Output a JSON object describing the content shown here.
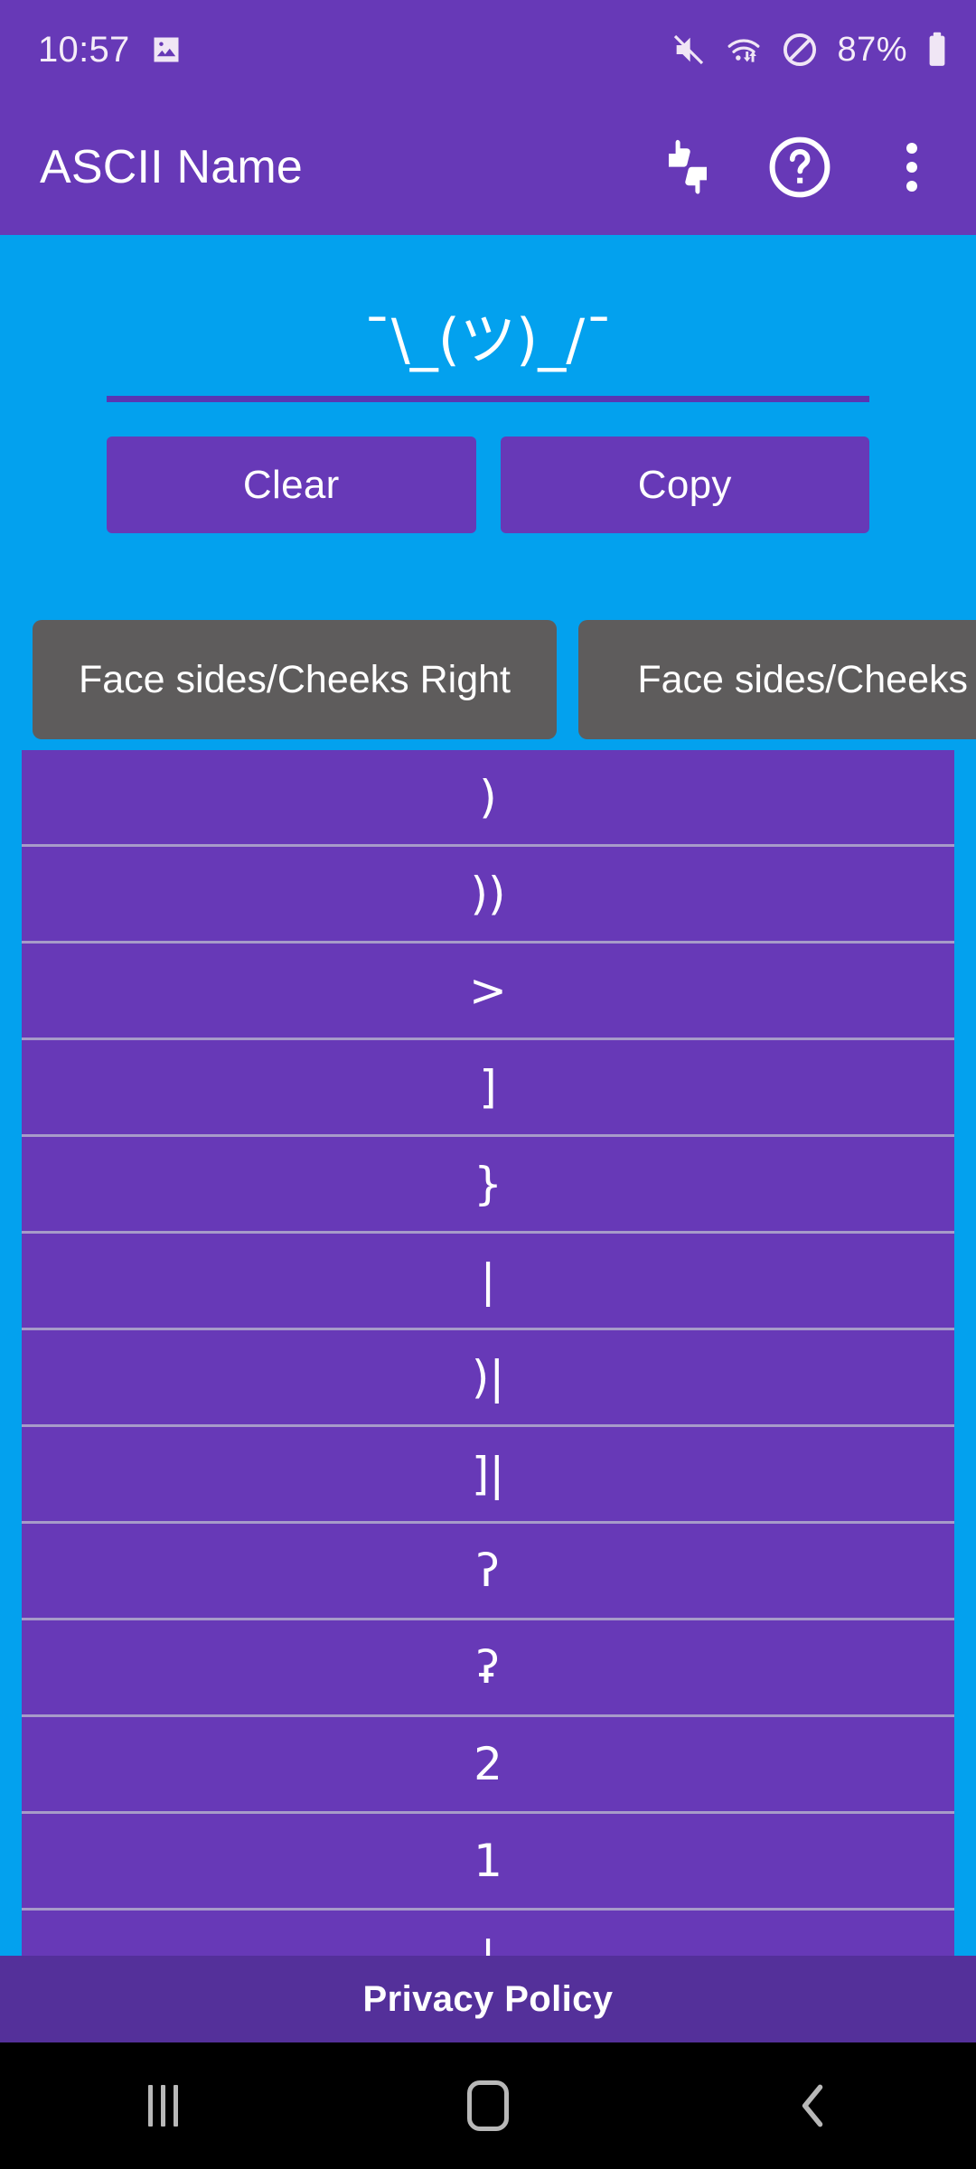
{
  "status_bar": {
    "time": "10:57",
    "battery_percent": "87%",
    "icons": [
      "image-icon",
      "mute-icon",
      "wifi-icon",
      "do-not-disturb-icon",
      "battery-icon"
    ]
  },
  "app_bar": {
    "title": "ASCII Name",
    "actions": [
      "thumbs-feedback-icon",
      "help-icon",
      "overflow-menu-icon"
    ]
  },
  "editor": {
    "value": "¯\\_(ツ)_/¯",
    "clear_label": "Clear",
    "copy_label": "Copy"
  },
  "tabs": [
    {
      "label": "Face sides/Cheeks Right",
      "selected": false
    },
    {
      "label": "Face sides/Cheeks Left",
      "selected": false
    }
  ],
  "list": {
    "items": [
      {
        "glyph": ")"
      },
      {
        "glyph": "))"
      },
      {
        "glyph": ">"
      },
      {
        "glyph": "]"
      },
      {
        "glyph": "}"
      },
      {
        "glyph": "|"
      },
      {
        "glyph": ")|"
      },
      {
        "glyph": "]|"
      },
      {
        "glyph": "ʔ"
      },
      {
        "glyph": "ʡ"
      },
      {
        "glyph": "2"
      },
      {
        "glyph": "1"
      },
      {
        "glyph": "|"
      },
      {
        "glyph": "."
      }
    ]
  },
  "footer": {
    "privacy_policy_label": "Privacy Policy"
  },
  "nav_bar": {
    "buttons": [
      "recents-icon",
      "home-icon",
      "back-icon"
    ]
  },
  "colors": {
    "primary_purple": "#6739B7",
    "background_cyan": "#03A1EE",
    "tab_gray": "#5E5C5C",
    "footer_purple": "#54309A",
    "divider": "#A79BC9",
    "underline": "#5935B3"
  }
}
